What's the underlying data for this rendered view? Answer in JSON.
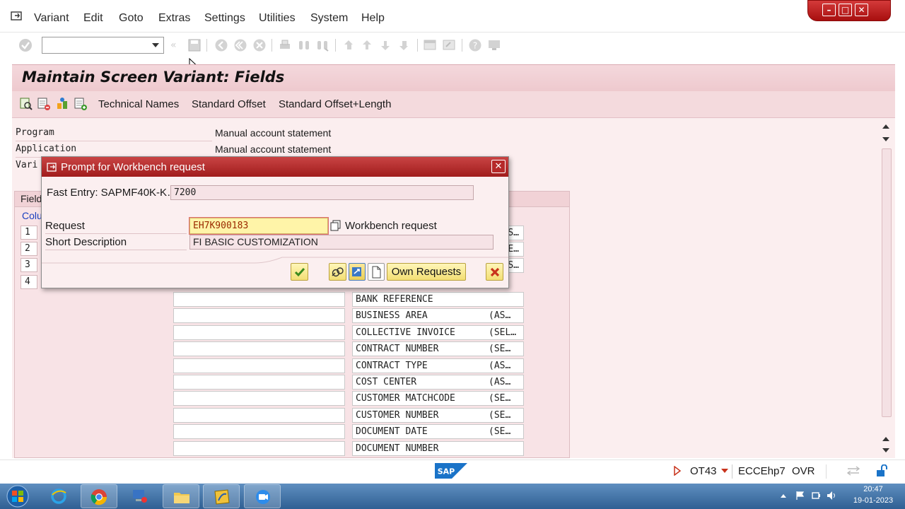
{
  "menu": {
    "items": [
      "Variant",
      "Edit",
      "Goto",
      "Extras",
      "Settings",
      "Utilities",
      "System",
      "Help"
    ]
  },
  "toolbar": {
    "command_field_value": "",
    "icons": [
      "enter-icon",
      "save-icon",
      "back-icon",
      "exit-icon",
      "cancel-icon",
      "print-icon",
      "find-icon",
      "find-next-icon",
      "first-page-icon",
      "previous-page-icon",
      "next-page-icon",
      "last-page-icon",
      "create-session-icon",
      "shortcut-icon",
      "help-icon",
      "customize-layout-icon"
    ]
  },
  "screen": {
    "title": "Maintain Screen Variant: Fields",
    "app_toolbar": {
      "technical_names": "Technical Names",
      "standard_offset": "Standard Offset",
      "standard_offset_length": "Standard Offset+Length"
    },
    "program_label": "Program",
    "program_value": "Manual account statement",
    "application_label": "Application",
    "application_value": "Manual account statement",
    "variant_label": "Vari",
    "fields_title": "Field",
    "column_link": "Colu",
    "row_numbers": [
      "1",
      "2",
      "3",
      "4"
    ],
    "field_list": [
      {
        "name": "BANK REFERENCE",
        "suffix": ""
      },
      {
        "name": "BUSINESS AREA",
        "suffix": "(AS…"
      },
      {
        "name": "COLLECTIVE INVOICE",
        "suffix": "(SEL…"
      },
      {
        "name": "CONTRACT NUMBER",
        "suffix": "(SE…"
      },
      {
        "name": "CONTRACT TYPE",
        "suffix": "(AS…"
      },
      {
        "name": "COST CENTER",
        "suffix": "(AS…"
      },
      {
        "name": "CUSTOMER MATCHCODE",
        "suffix": "(SE…"
      },
      {
        "name": "CUSTOMER NUMBER",
        "suffix": "(SE…"
      },
      {
        "name": "DOCUMENT DATE",
        "suffix": "(SE…"
      },
      {
        "name": "DOCUMENT NUMBER",
        "suffix": ""
      }
    ],
    "partial_right_cells": [
      "S…",
      "E…",
      "S…"
    ]
  },
  "dialog": {
    "title": "Prompt for Workbench request",
    "fast_entry_label": "Fast Entry: SAPMF40K-K…",
    "fast_entry_value": "7200",
    "request_label": "Request",
    "request_value": "EH7K900183",
    "request_type": "Workbench request",
    "short_description_label": "Short Description",
    "short_description_value": "FI BASIC CUSTOMIZATION",
    "own_requests_label": "Own Requests"
  },
  "status": {
    "transaction": "OT43",
    "system": "ECCEhp7",
    "mode": "OVR",
    "logo_text": "SAP"
  },
  "taskbar": {
    "time": "20:47",
    "date": "19-01-2023"
  },
  "colors": {
    "title_red": "#a11c1c",
    "pink_bg": "#fbeeef",
    "accent_yellow": "#f3df74",
    "sap_blue": "#1a73c8"
  }
}
